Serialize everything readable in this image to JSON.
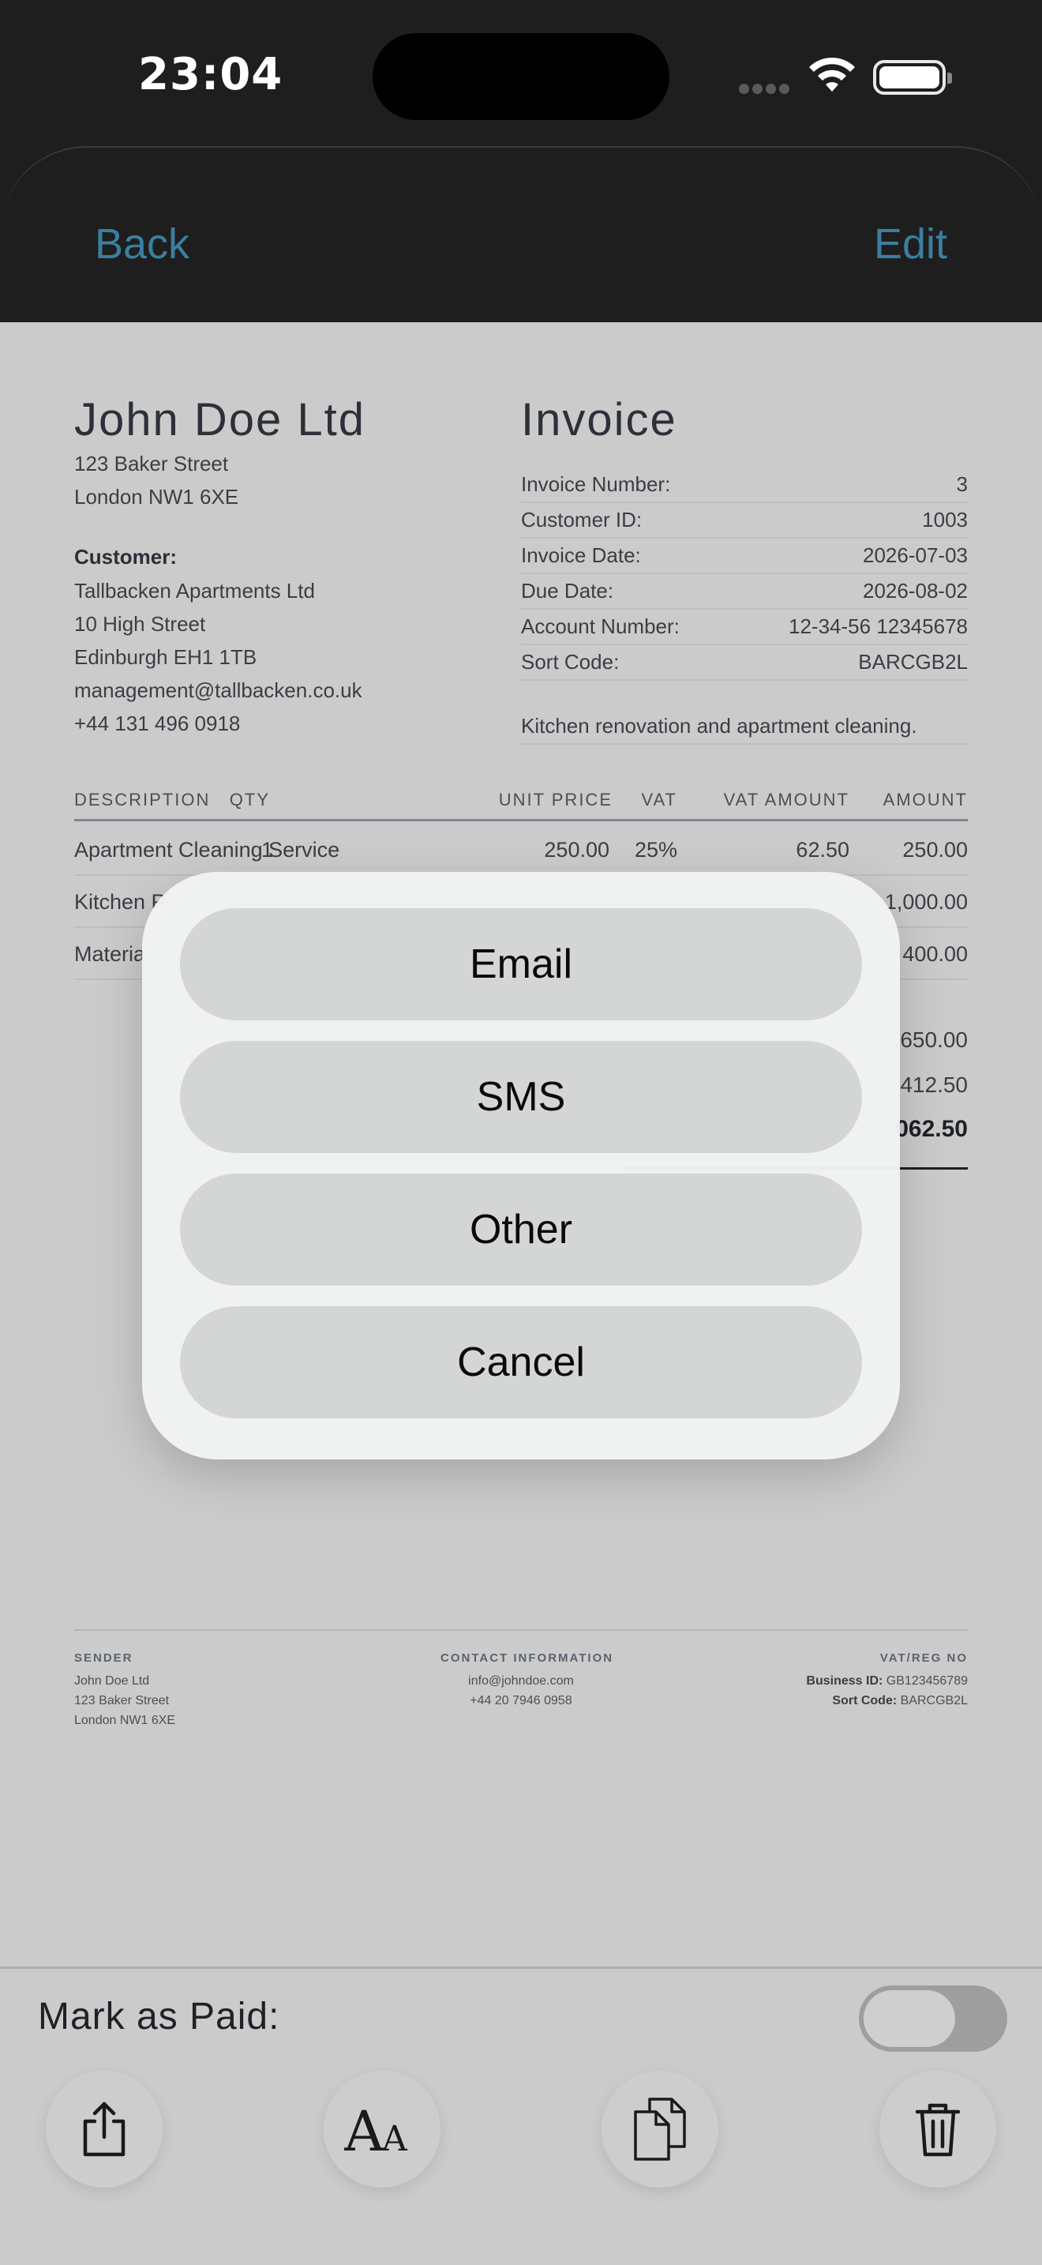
{
  "status": {
    "time": "23:04"
  },
  "nav": {
    "back": "Back",
    "edit": "Edit"
  },
  "sender": {
    "name": "John Doe Ltd",
    "address": [
      "123 Baker Street",
      "London NW1 6XE"
    ]
  },
  "customer": {
    "label": "Customer:",
    "lines": [
      "Tallbacken Apartments Ltd",
      "10 High Street",
      "Edinburgh EH1 1TB",
      "management@tallbacken.co.uk",
      "+44 131 496 0918"
    ]
  },
  "invoice": {
    "title": "Invoice",
    "meta": [
      {
        "label": "Invoice Number:",
        "value": "3"
      },
      {
        "label": "Customer ID:",
        "value": "1003"
      },
      {
        "label": "Invoice Date:",
        "value": "2026-07-03"
      },
      {
        "label": "Due Date:",
        "value": "2026-08-02"
      },
      {
        "label": "Account Number:",
        "value": "12-34-56 12345678"
      },
      {
        "label": "Sort Code:",
        "value": "BARCGB2L"
      }
    ],
    "notes": "Kitchen renovation and apartment cleaning."
  },
  "items": {
    "headers": {
      "desc": "DESCRIPTION",
      "qty": "QTY",
      "unit": "UNIT PRICE",
      "vat": "VAT",
      "vat_amount": "VAT AMOUNT",
      "amount": "AMOUNT"
    },
    "rows": [
      {
        "desc": "Apartment Cleaning Service",
        "qty": "1",
        "unit": "250.00",
        "vat": "25%",
        "vat_amount": "62.50",
        "amount": "250.00"
      },
      {
        "desc": "Kitchen R",
        "qty": "",
        "unit": "",
        "vat": "",
        "vat_amount": "",
        "amount": "1,000.00"
      },
      {
        "desc": "Materia",
        "qty": "",
        "unit": "",
        "vat": "",
        "vat_amount": "",
        "amount": "400.00"
      }
    ]
  },
  "totals": {
    "subtotal": ",650.00",
    "vat": "412.50",
    "total": "062.50"
  },
  "footer": {
    "sender_head": "SENDER",
    "sender_lines": [
      "John Doe Ltd",
      "123 Baker Street",
      "London NW1 6XE"
    ],
    "contact_head": "CONTACT INFORMATION",
    "contact_lines": [
      "info@johndoe.com",
      "+44 20 7946 0958"
    ],
    "vat_head": "VAT/REG NO",
    "business_id_label": "Business ID:",
    "business_id": "GB123456789",
    "sort_code_label": "Sort Code:",
    "sort_code": "BARCGB2L"
  },
  "paid": {
    "label": "Mark as Paid:",
    "checked": false
  },
  "toolbar": {
    "icons": [
      "share-icon",
      "font-icon",
      "duplicate-icon",
      "trash-icon"
    ]
  },
  "action_sheet": {
    "email": "Email",
    "sms": "SMS",
    "other": "Other",
    "cancel": "Cancel"
  },
  "colors": {
    "accent": "#3a7fa0",
    "doc_bg": "#cbcbcb",
    "header_bg": "#1e1e1e"
  }
}
